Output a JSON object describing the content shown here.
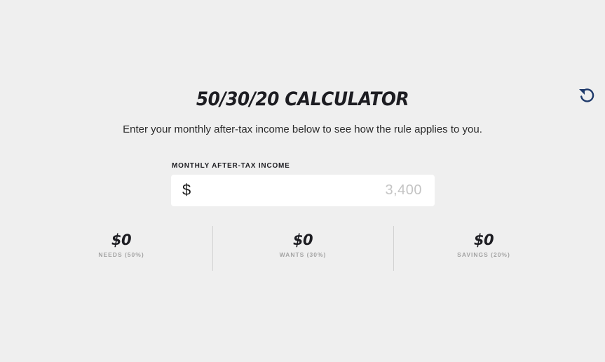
{
  "calculator": {
    "title": "50/30/20 CALCULATOR",
    "subtitle": "Enter your monthly after-tax income below to see how the rule applies to you.",
    "reset_icon": "reset-icon"
  },
  "income": {
    "label": "MONTHLY AFTER-TAX INCOME",
    "currency_symbol": "$",
    "value": "",
    "placeholder": "3,400"
  },
  "results": [
    {
      "amount": "$0",
      "label": "NEEDS (50%)"
    },
    {
      "amount": "$0",
      "label": "WANTS (30%)"
    },
    {
      "amount": "$0",
      "label": "SAVINGS (20%)"
    }
  ],
  "colors": {
    "background": "#efefef",
    "heading": "#1d1d22",
    "muted_label": "#a3a3a3",
    "placeholder": "#c4c4c4",
    "reset_icon": "#1f3a6b"
  }
}
